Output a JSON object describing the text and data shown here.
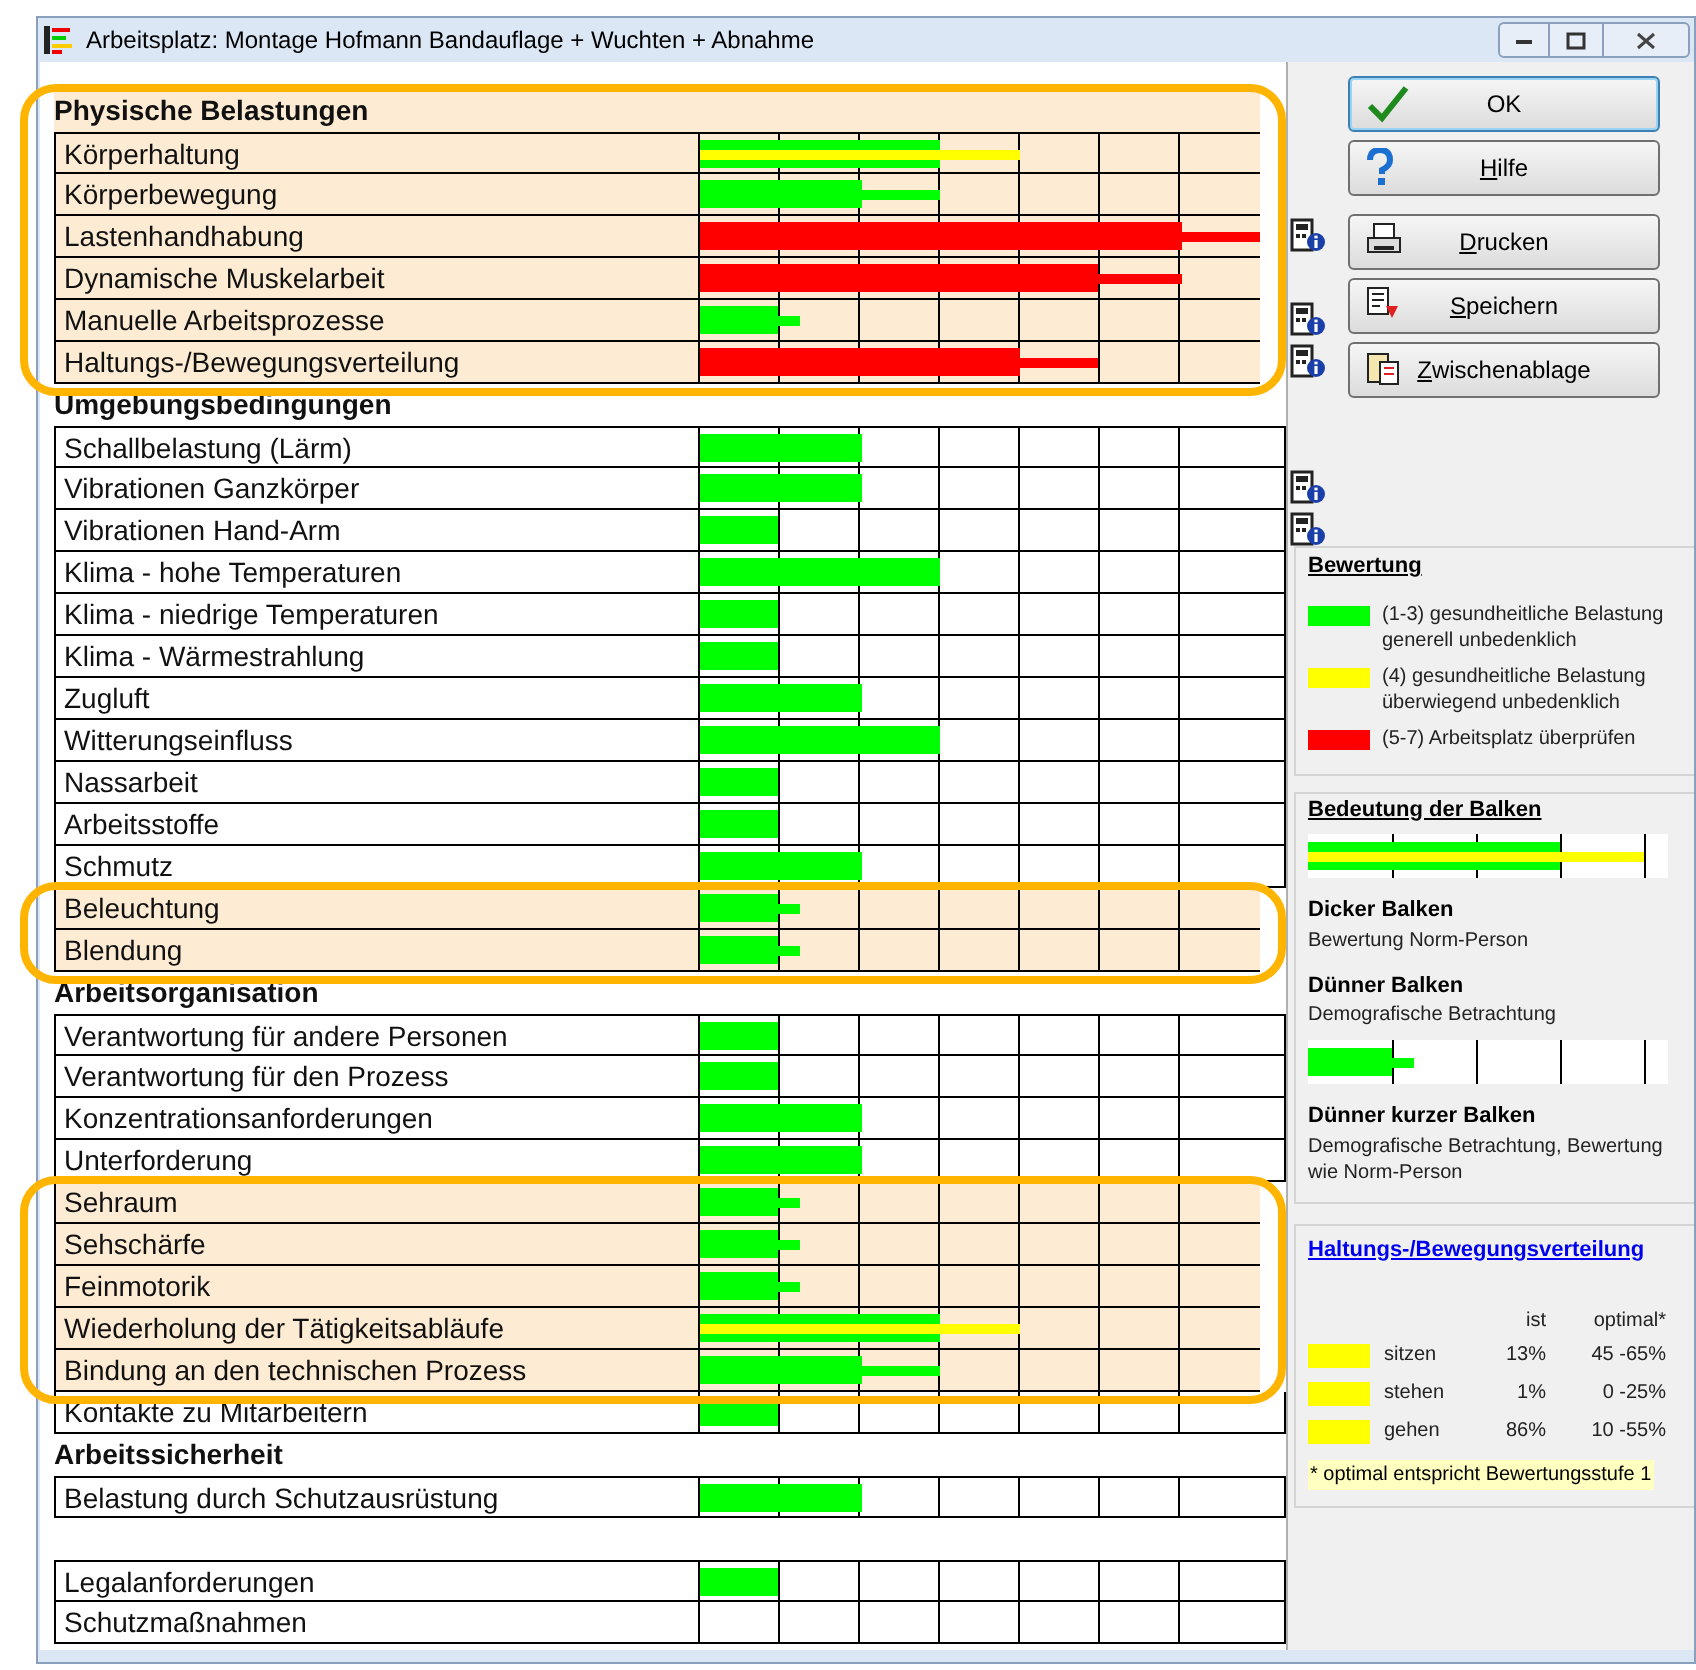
{
  "window": {
    "title": "Arbeitsplatz: Montage Hofmann Bandauflage + Wuchten + Abnahme"
  },
  "sections": [
    {
      "heading": "Physische Belastungen",
      "highlighted": true,
      "rows": [
        {
          "label": "Körperhaltung",
          "highlighted": true,
          "info": false,
          "thick": {
            "color": "#00ff00",
            "level": 0.43
          },
          "thin": {
            "color": "#ffff00",
            "level": 0.57
          }
        },
        {
          "label": "Körperbewegung",
          "highlighted": true,
          "info": false,
          "thick": {
            "color": "#00ff00",
            "level": 0.29
          },
          "thin": {
            "color": "#00ff00",
            "level": 0.43
          }
        },
        {
          "label": "Lastenhandhabung",
          "highlighted": true,
          "info": true,
          "thick": {
            "color": "#ff0000",
            "level": 0.86
          },
          "thin": {
            "color": "#ff0000",
            "level": 1
          }
        },
        {
          "label": "Dynamische Muskelarbeit",
          "highlighted": true,
          "info": false,
          "thick": {
            "color": "#ff0000",
            "level": 0.71
          },
          "thin": {
            "color": "#ff0000",
            "level": 0.86
          }
        },
        {
          "label": "Manuelle Arbeitsprozesse",
          "highlighted": true,
          "info": true,
          "thick": {
            "color": "#00ff00",
            "level": 0.14
          },
          "thin": {
            "color": "#00ff00",
            "level": 0.18
          }
        },
        {
          "label": "Haltungs-/Bewegungsverteilung",
          "highlighted": true,
          "info": true,
          "thick": {
            "color": "#ff0000",
            "level": 0.57
          },
          "thin": {
            "color": "#ff0000",
            "level": 0.71
          }
        }
      ]
    },
    {
      "heading": "Umgebungsbedingungen",
      "highlighted": false,
      "rows": [
        {
          "label": "Schallbelastung (Lärm)",
          "highlighted": false,
          "info": false,
          "thick": {
            "color": "#00ff00",
            "level": 0.29
          }
        },
        {
          "label": "Vibrationen Ganzkörper",
          "highlighted": false,
          "info": true,
          "thick": {
            "color": "#00ff00",
            "level": 0.29
          }
        },
        {
          "label": "Vibrationen Hand-Arm",
          "highlighted": false,
          "info": true,
          "thick": {
            "color": "#00ff00",
            "level": 0.14
          }
        },
        {
          "label": "Klima - hohe Temperaturen",
          "highlighted": false,
          "info": false,
          "thick": {
            "color": "#00ff00",
            "level": 0.43
          }
        },
        {
          "label": "Klima - niedrige Temperaturen",
          "highlighted": false,
          "info": false,
          "thick": {
            "color": "#00ff00",
            "level": 0.14
          }
        },
        {
          "label": "Klima - Wärmestrahlung",
          "highlighted": false,
          "info": false,
          "thick": {
            "color": "#00ff00",
            "level": 0.14
          }
        },
        {
          "label": "Zugluft",
          "highlighted": false,
          "info": false,
          "thick": {
            "color": "#00ff00",
            "level": 0.29
          }
        },
        {
          "label": "Witterungseinfluss",
          "highlighted": false,
          "info": false,
          "thick": {
            "color": "#00ff00",
            "level": 0.43
          }
        },
        {
          "label": "Nassarbeit",
          "highlighted": false,
          "info": false,
          "thick": {
            "color": "#00ff00",
            "level": 0.14
          }
        },
        {
          "label": "Arbeitsstoffe",
          "highlighted": false,
          "info": false,
          "thick": {
            "color": "#00ff00",
            "level": 0.14
          }
        },
        {
          "label": "Schmutz",
          "highlighted": false,
          "info": false,
          "thick": {
            "color": "#00ff00",
            "level": 0.29
          }
        },
        {
          "label": "Beleuchtung",
          "highlighted": true,
          "info": false,
          "thick": {
            "color": "#00ff00",
            "level": 0.14
          },
          "thin": {
            "color": "#00ff00",
            "level": 0.18
          }
        },
        {
          "label": "Blendung",
          "highlighted": true,
          "info": false,
          "thick": {
            "color": "#00ff00",
            "level": 0.14
          },
          "thin": {
            "color": "#00ff00",
            "level": 0.18
          }
        }
      ]
    },
    {
      "heading": "Arbeitsorganisation",
      "highlighted": false,
      "rows": [
        {
          "label": "Verantwortung für andere Personen",
          "highlighted": false,
          "info": false,
          "thick": {
            "color": "#00ff00",
            "level": 0.14
          }
        },
        {
          "label": "Verantwortung für den Prozess",
          "highlighted": false,
          "info": false,
          "thick": {
            "color": "#00ff00",
            "level": 0.14
          }
        },
        {
          "label": "Konzentrationsanforderungen",
          "highlighted": false,
          "info": false,
          "thick": {
            "color": "#00ff00",
            "level": 0.29
          }
        },
        {
          "label": "Unterforderung",
          "highlighted": false,
          "info": false,
          "thick": {
            "color": "#00ff00",
            "level": 0.29
          }
        },
        {
          "label": "Sehraum",
          "highlighted": true,
          "info": false,
          "thick": {
            "color": "#00ff00",
            "level": 0.14
          },
          "thin": {
            "color": "#00ff00",
            "level": 0.18
          }
        },
        {
          "label": "Sehschärfe",
          "highlighted": true,
          "info": false,
          "thick": {
            "color": "#00ff00",
            "level": 0.14
          },
          "thin": {
            "color": "#00ff00",
            "level": 0.18
          }
        },
        {
          "label": "Feinmotorik",
          "highlighted": true,
          "info": false,
          "thick": {
            "color": "#00ff00",
            "level": 0.14
          },
          "thin": {
            "color": "#00ff00",
            "level": 0.18
          }
        },
        {
          "label": "Wiederholung der Tätigkeitsabläufe",
          "highlighted": true,
          "info": false,
          "thick": {
            "color": "#00ff00",
            "level": 0.43
          },
          "thin": {
            "color": "#ffff00",
            "level": 0.57
          }
        },
        {
          "label": "Bindung an den technischen Prozess",
          "highlighted": true,
          "info": false,
          "thick": {
            "color": "#00ff00",
            "level": 0.29
          },
          "thin": {
            "color": "#00ff00",
            "level": 0.43
          }
        },
        {
          "label": "Kontakte zu Mitarbeitern",
          "highlighted": false,
          "info": false,
          "thick": {
            "color": "#00ff00",
            "level": 0.14
          }
        }
      ]
    },
    {
      "heading": "Arbeitssicherheit",
      "highlighted": false,
      "rows": [
        {
          "label": "Belastung durch Schutzausrüstung",
          "highlighted": false,
          "info": false,
          "thick": {
            "color": "#00ff00",
            "level": 0.29
          }
        }
      ]
    },
    {
      "rows": [
        {
          "label": "Legalanforderungen",
          "highlighted": false,
          "info": false,
          "thick": {
            "color": "#00ff00",
            "level": 0.14
          }
        },
        {
          "label": "Schutzmaßnahmen",
          "highlighted": false,
          "info": false
        }
      ]
    }
  ],
  "buttons": [
    {
      "label": "OK",
      "kind": "ok",
      "mnemonic": false
    },
    {
      "label": "Hilfe",
      "kind": "help",
      "mnemonic": true
    },
    {
      "label": "Drucken",
      "kind": "print",
      "mnemonic": true
    },
    {
      "label": "Speichern",
      "kind": "save",
      "mnemonic": true
    },
    {
      "label": "Zwischenablage",
      "kind": "clipboard",
      "mnemonic": true
    }
  ],
  "rating_legend": {
    "title": "Bewertung",
    "items": [
      {
        "color": "#00ff00",
        "text": "(1-3) gesundheitliche Belastung generell unbedenklich"
      },
      {
        "color": "#ffff00",
        "text": "(4) gesundheitliche Belastung überwiegend unbedenklich"
      },
      {
        "color": "#ff0000",
        "text": "(5-7) Arbeitsplatz überprüfen"
      }
    ]
  },
  "bar_meaning": {
    "title": "Bedeutung der Balken",
    "entries": [
      {
        "heading": "Dicker Balken",
        "text": "Bewertung Norm-Person"
      },
      {
        "heading": "Dünner Balken",
        "text": "Demografische Betrachtung"
      },
      {
        "heading": "Dünner kurzer Balken",
        "text": "Demografische Betrachtung, Bewertung wie Norm-Person"
      }
    ]
  },
  "distribution": {
    "title": "Haltungs-/Bewegungsverteilung",
    "columns": [
      "ist",
      "optimal*"
    ],
    "rows": [
      {
        "label": "sitzen",
        "color": "#ffff00",
        "ist": "13%",
        "optimal": "45 -65%"
      },
      {
        "label": "stehen",
        "color": "#ffff00",
        "ist": "1%",
        "optimal": "0 -25%"
      },
      {
        "label": "gehen",
        "color": "#ffff00",
        "ist": "86%",
        "optimal": "10 -55%"
      }
    ],
    "footnote": "* optimal entspricht Bewertungsstufe 1"
  }
}
